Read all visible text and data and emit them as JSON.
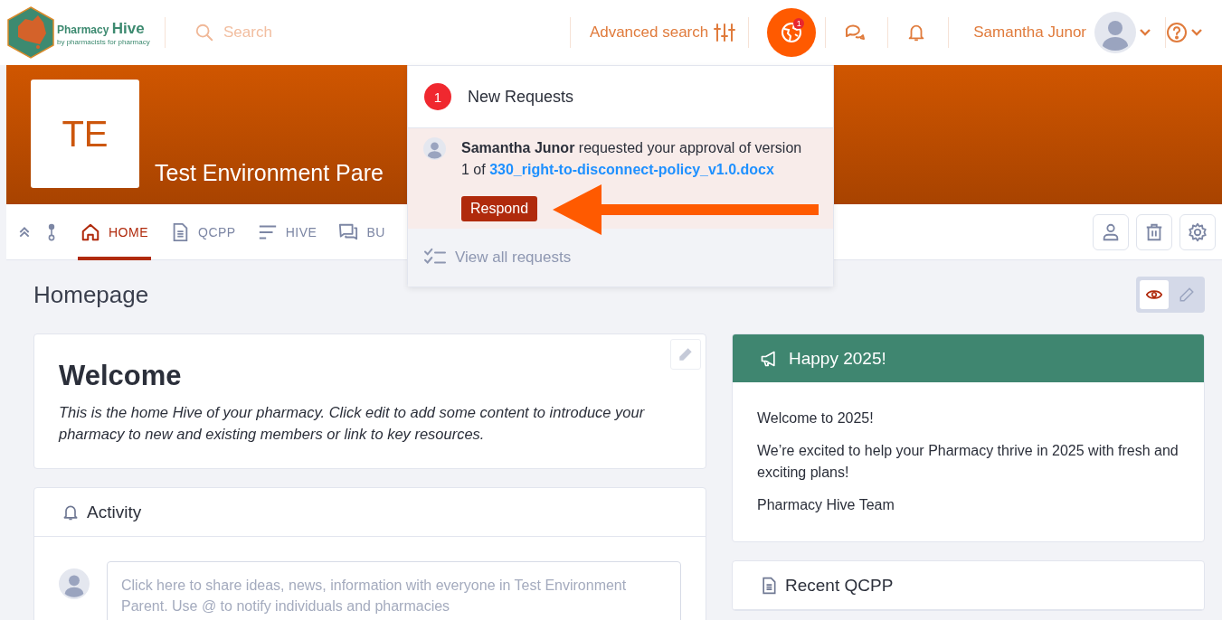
{
  "header": {
    "logo": {
      "name": "Pharmacy",
      "name_strong": "Hive",
      "tagline": "by pharmacists for pharmacy"
    },
    "search": {
      "placeholder": "Search"
    },
    "advanced_search": "Advanced search",
    "requests_badge": "1",
    "user_name": "Samantha Junor"
  },
  "banner": {
    "initials": "TE",
    "title": "Test Environment Pare"
  },
  "tabs": [
    {
      "label": "HOME",
      "kind": "home",
      "selected": true
    },
    {
      "label": "QCPP",
      "kind": "document",
      "selected": false
    },
    {
      "label": "HIVE",
      "kind": "lines",
      "selected": false
    },
    {
      "label": "BU",
      "kind": "chat",
      "selected": false
    }
  ],
  "requests_dropdown": {
    "count": "1",
    "title": "New Requests",
    "request": {
      "text": "**Samantha Junor** requested your approval of version 1 of",
      "link": "330_right-to-disconnect-policy_v1.0.docx",
      "button": "Respond"
    },
    "footer": "View all requests"
  },
  "page_title": "Homepage",
  "view_toggle": [
    {
      "kind": "view",
      "selected": true
    },
    {
      "kind": "edit",
      "selected": false
    }
  ],
  "welcome": {
    "title": "Welcome",
    "body": "This is the home Hive of your pharmacy. Click edit to add some content to introduce your pharmacy to new and existing members or link to key resources."
  },
  "activity": {
    "title": "Activity",
    "placeholder": "Click here to share ideas, news, information with everyone in Test Environment Parent. Use @ to notify individuals and pharmacies"
  },
  "announcement": {
    "title": "Happy 2025!",
    "paragraphs": [
      "Welcome to 2025!",
      "We’re excited to help your Pharmacy thrive in 2025 with fresh and exciting plans!",
      "Pharmacy Hive Team"
    ]
  },
  "recent": {
    "title": "Recent QCPP"
  }
}
